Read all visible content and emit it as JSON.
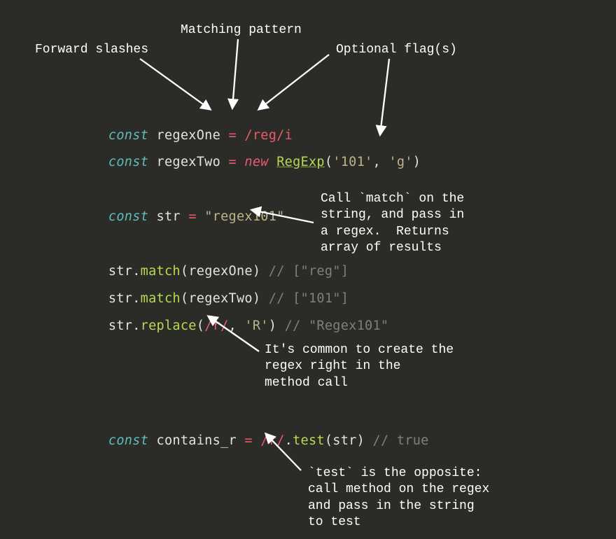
{
  "annotations": {
    "forward_slashes": "Forward slashes",
    "matching_pattern": "Matching pattern",
    "optional_flags": "Optional flag(s)",
    "match_note": "Call `match` on the\nstring, and pass in\na regex.  Returns\narray of results",
    "inline_note": "It's common to create the\nregex right in the\nmethod call",
    "test_note": "`test` is the opposite:\ncall method on the regex\nand pass in the string\nto test"
  },
  "code": {
    "l1": {
      "keyword": "const",
      "var": "regexOne",
      "eq": "=",
      "regex": "/reg/i"
    },
    "l2": {
      "keyword": "const",
      "var": "regexTwo",
      "eq": "=",
      "new": "new",
      "class": "RegExp",
      "str1": "'101'",
      "comma": ", ",
      "str2": "'g'"
    },
    "l3": {
      "keyword": "const",
      "var": "str",
      "eq": "=",
      "string": "\"regex101\""
    },
    "l4": {
      "obj": "str",
      "method": "match",
      "arg": "regexOne",
      "comment": "// [\"reg\"]"
    },
    "l5": {
      "obj": "str",
      "method": "match",
      "arg": "regexTwo",
      "comment": "// [\"101\"]"
    },
    "l6": {
      "obj": "str",
      "method": "replace",
      "regex": "/r/",
      "comma": ", ",
      "str": "'R'",
      "comment": "// \"Regex101\""
    },
    "l7": {
      "keyword": "const",
      "var": "contains_r",
      "eq": "=",
      "regex": "/r/",
      "method": "test",
      "arg": "str",
      "comment": "// true"
    }
  }
}
